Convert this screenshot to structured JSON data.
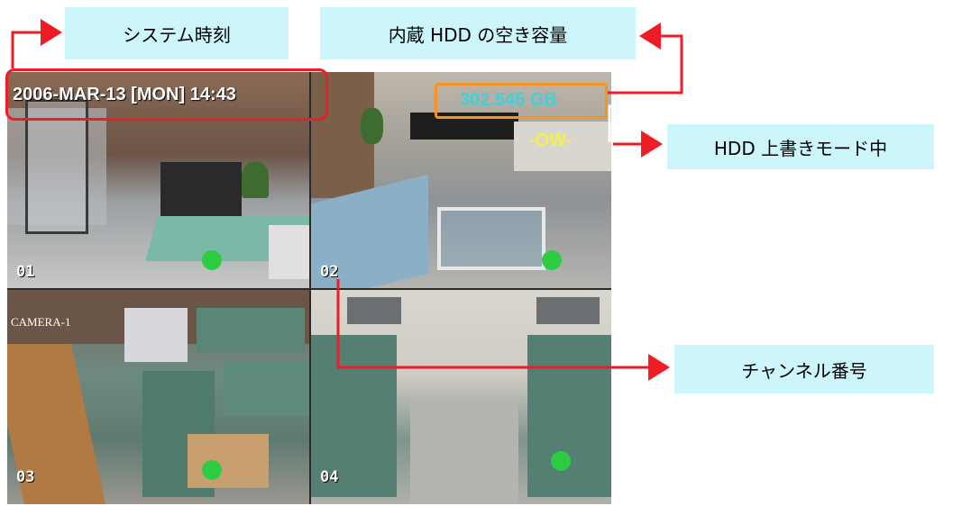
{
  "callouts": {
    "system_time": "システム時刻",
    "hdd_free": "内蔵 HDD の空き容量",
    "overwrite_mode": "HDD 上書きモード中",
    "channel_number": "チャンネル番号"
  },
  "osd": {
    "datetime": "2006-MAR-13 [MON] 14:43",
    "hdd_capacity": "302.545 GB",
    "overwrite_flag": "-OW-"
  },
  "channels": [
    {
      "number": "01"
    },
    {
      "number": "02"
    },
    {
      "number": "03",
      "camera_label": "CAMERA-1"
    },
    {
      "number": "04"
    }
  ],
  "colors": {
    "callout_bg": "#ccf6fb",
    "arrow": "#ee1c25",
    "time_frame": "#ee1c25",
    "hdd_frame": "#f7941d",
    "hdd_text": "#40d0d8",
    "ow_text": "#f6f04a",
    "record_dot": "#2ecc40"
  }
}
